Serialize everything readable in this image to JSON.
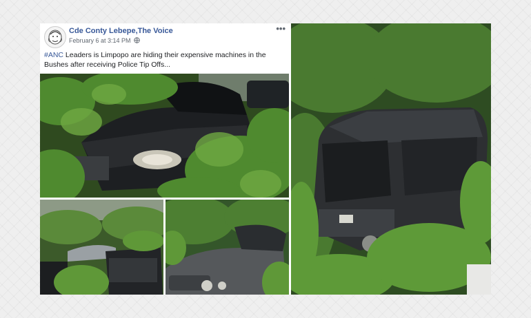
{
  "post": {
    "author": "Cde Conty Lebepe,The Voice",
    "timestamp": "February 6 at 3:14 PM",
    "privacy_icon": "globe-icon",
    "more_label": "•••",
    "hashtag": "#ANC",
    "text": " Leaders is Limpopo are hiding their expensive machines in the Bushes after receiving Police Tip Offs..."
  },
  "photos": [
    {
      "subject": "mercedes-suv-in-bushes"
    },
    {
      "subject": "cars-overgrown-yard"
    },
    {
      "subject": "bentley-in-bushes"
    },
    {
      "subject": "range-rover-in-bushes"
    }
  ],
  "colors": {
    "link_blue": "#385898",
    "meta_gray": "#606770",
    "foliage": "#3f6b2a"
  }
}
